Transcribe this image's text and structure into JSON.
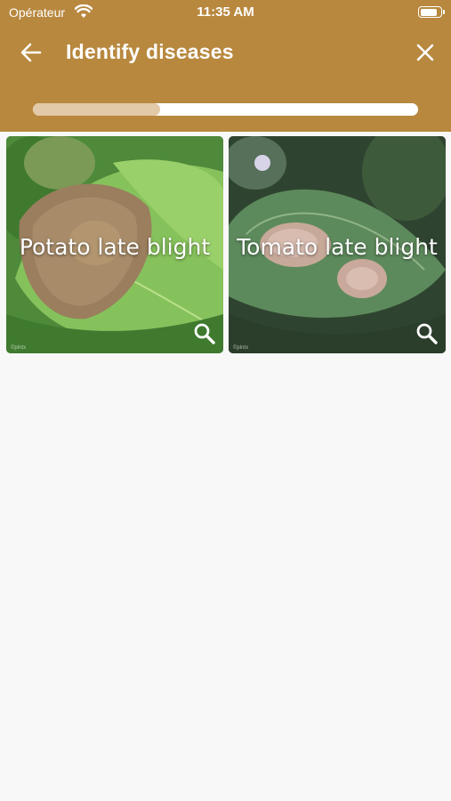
{
  "status_bar": {
    "carrier": "Opérateur",
    "time": "11:35 AM",
    "battery_level": 0.85
  },
  "header": {
    "title": "Identify diseases",
    "back_icon": "arrow-left-icon",
    "close_icon": "close-icon",
    "progress": 0.33
  },
  "cards": [
    {
      "label": "Potato late blight",
      "icon": "search-icon",
      "credit": "©plntx"
    },
    {
      "label": "Tomato late blight",
      "icon": "search-icon",
      "credit": "©plntx"
    }
  ],
  "colors": {
    "header": "#b8883f",
    "progress_fill": "#e2c9a7",
    "background": "#f8f8f8"
  }
}
